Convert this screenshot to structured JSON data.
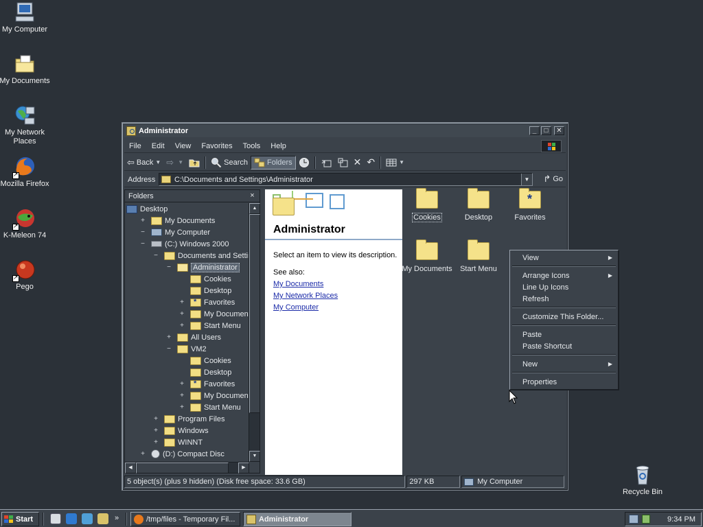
{
  "desktop": {
    "icons": [
      {
        "label": "My Computer",
        "icon": "my-computer-icon"
      },
      {
        "label": "My Documents",
        "icon": "my-documents-icon"
      },
      {
        "label": "My Network Places",
        "icon": "network-places-icon"
      },
      {
        "label": "Mozilla Firefox",
        "icon": "firefox-icon"
      },
      {
        "label": "K-Meleon 74",
        "icon": "k-meleon-icon"
      },
      {
        "label": "Pego",
        "icon": "pego-icon"
      }
    ],
    "recycle_bin": "Recycle Bin"
  },
  "window": {
    "title": "Administrator",
    "controls": {
      "minimize": "_",
      "maximize": "□",
      "close": "✕"
    },
    "menu": [
      "File",
      "Edit",
      "View",
      "Favorites",
      "Tools",
      "Help"
    ],
    "menu_underline": [
      "F",
      "E",
      "V",
      "a",
      "T",
      "H"
    ],
    "toolbar": {
      "back": "Back",
      "search": "Search",
      "folders": "Folders"
    },
    "address": {
      "label": "Address",
      "value": "C:\\Documents and Settings\\Administrator",
      "go": "Go"
    },
    "folders_pane": {
      "title": "Folders",
      "close": "×",
      "tree": [
        {
          "label": "Desktop",
          "level": 0,
          "pm": "",
          "icon": "desk"
        },
        {
          "label": "My Documents",
          "level": 1,
          "pm": "+",
          "icon": "docs"
        },
        {
          "label": "My Computer",
          "level": 1,
          "pm": "−",
          "icon": "comp"
        },
        {
          "label": "(C:) Windows 2000",
          "level": 2,
          "pm": "−",
          "icon": "drive"
        },
        {
          "label": "Documents and Settin",
          "level": 3,
          "pm": "−",
          "icon": "folder"
        },
        {
          "label": "Administrator",
          "level": 4,
          "pm": "−",
          "icon": "folder open",
          "selected": true
        },
        {
          "label": "Cookies",
          "level": 5,
          "pm": "",
          "icon": "folder"
        },
        {
          "label": "Desktop",
          "level": 5,
          "pm": "",
          "icon": "folder"
        },
        {
          "label": "Favorites",
          "level": 5,
          "pm": "+",
          "icon": "folder fav"
        },
        {
          "label": "My Document",
          "level": 5,
          "pm": "+",
          "icon": "folder"
        },
        {
          "label": "Start Menu",
          "level": 5,
          "pm": "+",
          "icon": "folder"
        },
        {
          "label": "All Users",
          "level": 4,
          "pm": "+",
          "icon": "folder"
        },
        {
          "label": "VM2",
          "level": 4,
          "pm": "−",
          "icon": "folder"
        },
        {
          "label": "Cookies",
          "level": 5,
          "pm": "",
          "icon": "folder"
        },
        {
          "label": "Desktop",
          "level": 5,
          "pm": "",
          "icon": "folder"
        },
        {
          "label": "Favorites",
          "level": 5,
          "pm": "+",
          "icon": "folder fav"
        },
        {
          "label": "My Document",
          "level": 5,
          "pm": "+",
          "icon": "folder"
        },
        {
          "label": "Start Menu",
          "level": 5,
          "pm": "+",
          "icon": "folder"
        },
        {
          "label": "Program Files",
          "level": 3,
          "pm": "+",
          "icon": "folder"
        },
        {
          "label": "Windows",
          "level": 3,
          "pm": "+",
          "icon": "folder"
        },
        {
          "label": "WINNT",
          "level": 3,
          "pm": "+",
          "icon": "folder"
        },
        {
          "label": "(D:) Compact Disc",
          "level": 2,
          "pm": "+",
          "icon": "cd"
        }
      ]
    },
    "info_panel": {
      "title": "Administrator",
      "description": "Select an item to view its description.",
      "see_also": "See also:",
      "links": [
        "My Documents",
        "My Network Places",
        "My Computer"
      ]
    },
    "items": [
      {
        "label": "Cookies",
        "fav": false,
        "focused": true
      },
      {
        "label": "Desktop",
        "fav": false,
        "focused": false
      },
      {
        "label": "Favorites",
        "fav": true,
        "focused": false
      },
      {
        "label": "My Documents",
        "fav": false,
        "focused": false
      },
      {
        "label": "Start Menu",
        "fav": false,
        "focused": false
      }
    ],
    "status": {
      "objects": "5 object(s) (plus 9 hidden) (Disk free space: 33.6 GB)",
      "size": "297 KB",
      "zone": "My Computer"
    }
  },
  "context_menu": {
    "items": [
      {
        "label": "View",
        "submenu": true
      },
      {
        "separator": true
      },
      {
        "label": "Arrange Icons",
        "submenu": true
      },
      {
        "label": "Line Up Icons",
        "submenu": false
      },
      {
        "label": "Refresh",
        "submenu": false
      },
      {
        "separator": true
      },
      {
        "label": "Customize This Folder...",
        "submenu": false
      },
      {
        "separator": true
      },
      {
        "label": "Paste",
        "submenu": false
      },
      {
        "label": "Paste Shortcut",
        "submenu": false
      },
      {
        "separator": true
      },
      {
        "label": "New",
        "submenu": true
      },
      {
        "separator": true
      },
      {
        "label": "Properties",
        "submenu": false
      }
    ]
  },
  "taskbar": {
    "start": "Start",
    "tasks": [
      {
        "label": "/tmp/files - Temporary Fil...",
        "active": false
      },
      {
        "label": "Administrator",
        "active": true
      }
    ],
    "clock": "9:34 PM"
  },
  "colors": {
    "desktop": "#2b3138",
    "window_face": "#3b424a",
    "link": "#1a2aa8",
    "folder": "#f5e28a"
  }
}
